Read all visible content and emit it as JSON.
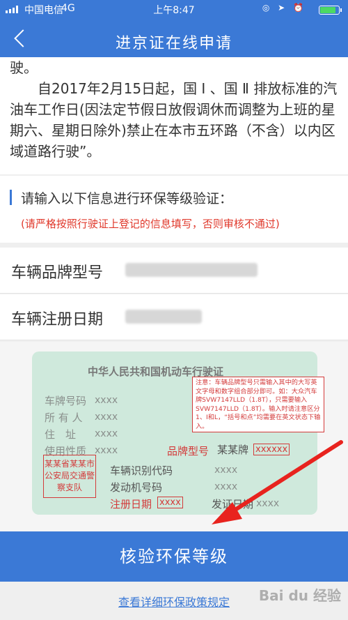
{
  "status": {
    "carrier": "中国电信",
    "network": "4G",
    "time": "上午8:47",
    "battery_icons": "◎ ➤ ⏰"
  },
  "nav": {
    "title": "进京证在线申请"
  },
  "notice": {
    "line1": "驶。",
    "para": "自2017年2月15日起，国 Ⅰ 、国 Ⅱ 排放标准的汽油车工作日(因法定节假日放假调休而调整为上班的星期六、星期日除外)禁止在本市五环路（不含）以内区域道路行驶”。"
  },
  "verify": {
    "heading": "请输入以下信息进行环保等级验证：",
    "warning": "(请严格按照行驶证上登记的信息填写，否则审核不通过)"
  },
  "fields": {
    "model_label": "车辆品牌型号",
    "model_value": "",
    "date_label": "车辆注册日期",
    "date_value": ""
  },
  "card": {
    "title": "中华人民共和国机动车行驶证",
    "plate_label": "车牌号码",
    "plate_value": "xxxx",
    "owner_label": "所 有 人",
    "owner_value": "xxxx",
    "address_label": "住　址",
    "address_value": "xxxx",
    "usage_label": "使用性质",
    "usage_value": "xxxx",
    "brand_label": "品牌型号",
    "brand_value": "某某牌",
    "brand_box": "xxxxxx",
    "vin_label": "车辆识别代码",
    "vin_value": "xxxx",
    "engine_label": "发动机号码",
    "engine_value": "xxxx",
    "reg_label": "注册日期",
    "reg_box": "xxxx",
    "issue_label": "发证日期",
    "issue_value": "xxxx",
    "stamp": "某某省某某市公安局交通警察支队"
  },
  "tip": "注意：车辆品牌型号只需输入其中的大写英文字母和数字组合部分即可。如：大众汽车牌SVW7147LLD（1.8T），只需要输入SVW7147LLD（1.8T）。输入时请注意区分1、I和L，“括号和点”均需要在英文状态下输入。",
  "cta": {
    "label": "核验环保等级"
  },
  "policy_link": "查看详细环保政策规定",
  "watermark": "Bai du 经验",
  "colors": {
    "primary": "#3b79d6",
    "warning": "#e0382b",
    "card": "#cfe9dc"
  }
}
